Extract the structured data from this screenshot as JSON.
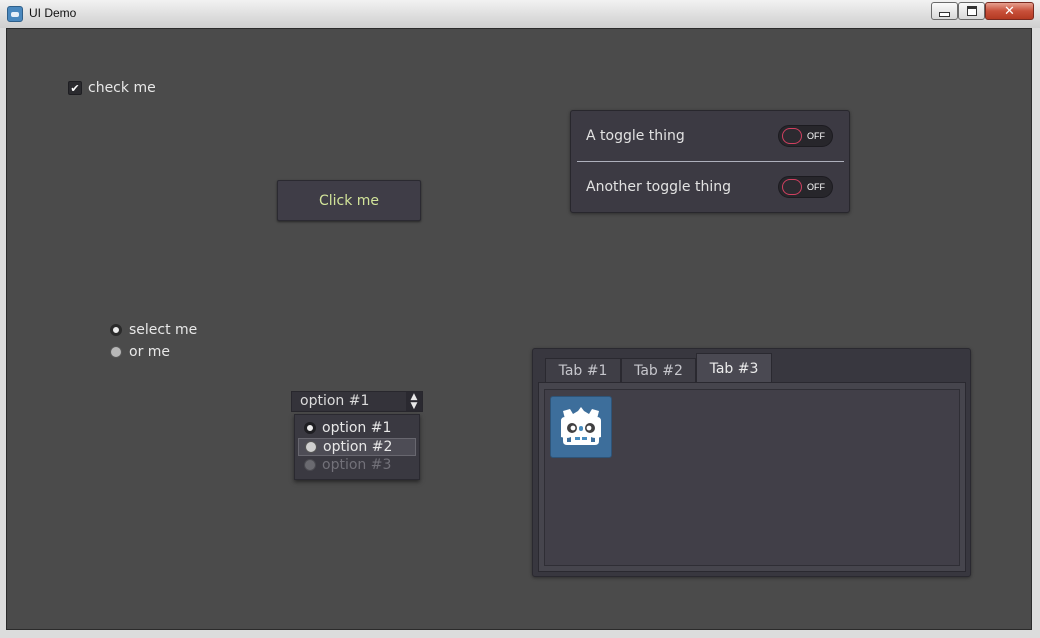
{
  "window": {
    "title": "UI Demo",
    "close_glyph": "✕"
  },
  "checkbox": {
    "label": "check me",
    "checked": true,
    "mark": "✔"
  },
  "button": {
    "label": "Click me",
    "text_color": "#d2e49a"
  },
  "toggles": [
    {
      "label": "A toggle thing",
      "state": "OFF"
    },
    {
      "label": "Another toggle thing",
      "state": "OFF"
    }
  ],
  "radios": [
    {
      "label": "select me",
      "selected": true
    },
    {
      "label": "or me",
      "selected": false
    }
  ],
  "option_button": {
    "value": "option #1",
    "arrow_up": "▲",
    "arrow_down": "▼",
    "options": [
      {
        "label": "option #1",
        "state": "selected"
      },
      {
        "label": "option #2",
        "state": "hovered"
      },
      {
        "label": "option #3",
        "state": "disabled"
      }
    ]
  },
  "tabs": {
    "items": [
      {
        "label": "Tab #1"
      },
      {
        "label": "Tab #2"
      },
      {
        "label": "Tab #3"
      }
    ],
    "active": "Tab #3",
    "content_icon": "godot-logo-icon"
  },
  "colors": {
    "background": "#4b4b4b",
    "panel": "#3c3a43",
    "toggle_accent": "#d04060",
    "logo_blue": "#478cbf"
  }
}
